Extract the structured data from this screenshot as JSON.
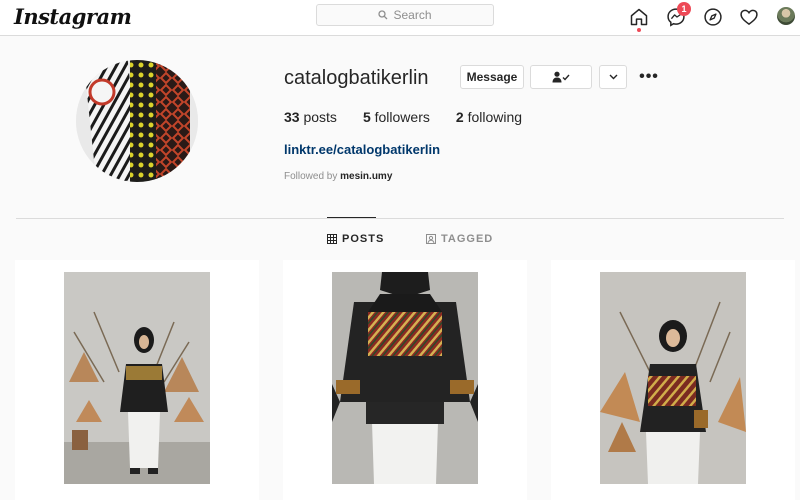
{
  "nav": {
    "logo": "Instagram",
    "search_placeholder": "Search",
    "messages_badge": "1",
    "icons": [
      "home-icon",
      "messenger-icon",
      "explore-icon",
      "activity-heart-icon",
      "profile-avatar"
    ]
  },
  "profile": {
    "username": "catalogbatikerlin",
    "message_label": "Message",
    "posts_count": "33",
    "posts_label": "posts",
    "followers_count": "5",
    "followers_label": "followers",
    "following_count": "2",
    "following_label": "following",
    "link": "linktr.ee/catalogbatikerlin",
    "followed_by_prefix": "Followed by",
    "followed_by_user": "mesin.umy"
  },
  "tabs": [
    {
      "label": "POSTS",
      "active": true
    },
    {
      "label": "TAGGED",
      "active": false
    }
  ],
  "colors": {
    "accent_badge": "#ed4956",
    "link": "#00376b",
    "border": "#dbdbdb",
    "muted": "#8e8e8e"
  }
}
